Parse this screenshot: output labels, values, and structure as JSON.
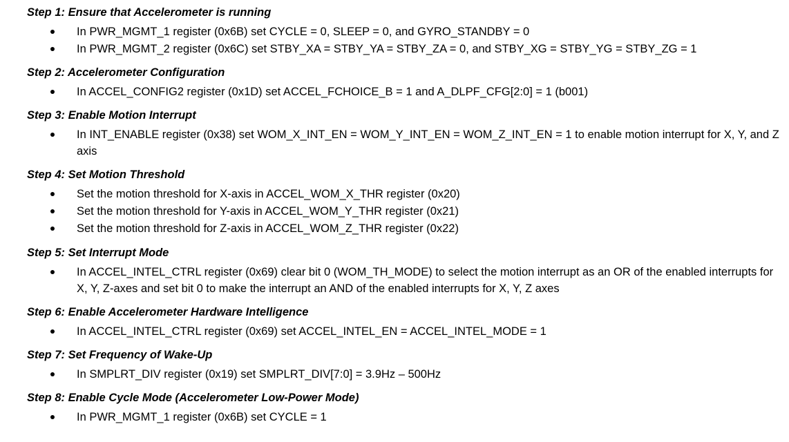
{
  "steps": [
    {
      "title": "Step 1: Ensure that Accelerometer is running",
      "bullets": [
        "In PWR_MGMT_1 register (0x6B) set CYCLE = 0, SLEEP = 0, and GYRO_STANDBY = 0",
        "In PWR_MGMT_2 register (0x6C) set STBY_XA = STBY_YA = STBY_ZA = 0, and STBY_XG = STBY_YG = STBY_ZG = 1"
      ]
    },
    {
      "title": "Step 2: Accelerometer Configuration",
      "bullets": [
        "In ACCEL_CONFIG2 register (0x1D) set ACCEL_FCHOICE_B = 1 and A_DLPF_CFG[2:0] = 1 (b001)"
      ]
    },
    {
      "title": "Step 3: Enable Motion Interrupt",
      "bullets": [
        "In INT_ENABLE register (0x38) set WOM_X_INT_EN = WOM_Y_INT_EN = WOM_Z_INT_EN = 1 to enable motion interrupt for X, Y, and Z axis"
      ]
    },
    {
      "title": "Step 4: Set Motion Threshold",
      "bullets": [
        "Set the motion threshold for X-axis in ACCEL_WOM_X_THR register (0x20)",
        "Set the motion threshold for Y-axis in ACCEL_WOM_Y_THR register (0x21)",
        "Set the motion threshold for Z-axis in ACCEL_WOM_Z_THR register (0x22)"
      ]
    },
    {
      "title": "Step 5: Set Interrupt Mode",
      "bullets": [
        "In ACCEL_INTEL_CTRL register (0x69) clear bit 0 (WOM_TH_MODE) to select the motion interrupt as an OR of the enabled interrupts for X, Y, Z-axes and set bit 0 to make the interrupt an AND of the enabled interrupts for X, Y, Z axes"
      ]
    },
    {
      "title": "Step 6: Enable Accelerometer Hardware Intelligence",
      "bullets": [
        "In ACCEL_INTEL_CTRL register (0x69) set ACCEL_INTEL_EN = ACCEL_INTEL_MODE = 1"
      ]
    },
    {
      "title": "Step 7: Set Frequency of Wake-Up",
      "bullets": [
        "In SMPLRT_DIV register (0x19) set SMPLRT_DIV[7:0] = 3.9Hz – 500Hz"
      ]
    },
    {
      "title": "Step 8: Enable Cycle Mode (Accelerometer Low-Power Mode)",
      "bullets": [
        "In PWR_MGMT_1 register (0x6B) set CYCLE = 1"
      ]
    }
  ]
}
